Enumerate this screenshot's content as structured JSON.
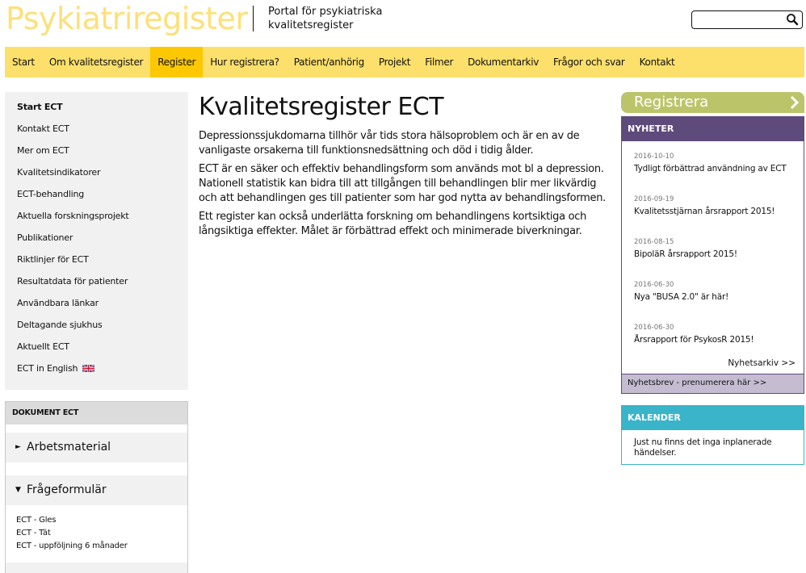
{
  "header": {
    "logo": "Psykiatriregister",
    "tagline_line1": "Portal för psykiatriska",
    "tagline_line2": "kvalitetsregister",
    "search": {
      "value": "",
      "placeholder": "",
      "icon": "search-icon"
    }
  },
  "nav": {
    "items": [
      {
        "label": "Start",
        "active": false
      },
      {
        "label": "Om kvalitetsregister",
        "active": false
      },
      {
        "label": "Register",
        "active": true
      },
      {
        "label": "Hur registrera?",
        "active": false
      },
      {
        "label": "Patient/anhörig",
        "active": false
      },
      {
        "label": "Projekt",
        "active": false
      },
      {
        "label": "Filmer",
        "active": false
      },
      {
        "label": "Dokumentarkiv",
        "active": false
      },
      {
        "label": "Frågor och svar",
        "active": false
      },
      {
        "label": "Kontakt",
        "active": false
      }
    ]
  },
  "sidebar": {
    "items": [
      {
        "label": "Start ECT",
        "active": true
      },
      {
        "label": "Kontakt ECT"
      },
      {
        "label": "Mer om ECT"
      },
      {
        "label": "Kvalitetsindikatorer"
      },
      {
        "label": "ECT-behandling"
      },
      {
        "label": "Aktuella forskningsprojekt"
      },
      {
        "label": "Publikationer"
      },
      {
        "label": "Riktlinjer för ECT"
      },
      {
        "label": "Resultatdata för patienter"
      },
      {
        "label": "Användbara länkar"
      },
      {
        "label": "Deltagande sjukhus"
      },
      {
        "label": "Aktuellt ECT"
      },
      {
        "label": "ECT in English",
        "icon": "uk-flag-icon"
      }
    ]
  },
  "documents": {
    "title": "DOKUMENT ECT",
    "sections": [
      {
        "label": "Arbetsmaterial",
        "expanded": false,
        "items": []
      },
      {
        "label": "Frågeformulär",
        "expanded": true,
        "items": [
          "ECT - Gles",
          "ECT - Tät",
          "ECT - uppföljning 6 månader"
        ]
      }
    ]
  },
  "main": {
    "title": "Kvalitetsregister ECT",
    "paragraphs": [
      "Depressionssjukdomarna tillhör vår tids stora hälsoproblem och är en av de vanligaste orsakerna till funktionsnedsättning och död i tidig ålder.",
      "ECT är en säker och effektiv behandlingsform som används mot bl a depression. Nationell statistik kan bidra till att tillgången till behandlingen blir mer likvärdig och att behandlingen ges till patienter som har god nytta av behandlingsformen.",
      "Ett register kan också underlätta forskning om behandlingens kortsiktiga och långsiktiga effekter. Målet är förbättrad effekt och minimerade biverkningar."
    ]
  },
  "right": {
    "register_button": "Registrera",
    "news": {
      "title": "NYHETER",
      "items": [
        {
          "date": "2016-10-10",
          "title": "Tydligt förbättrad användning av ECT"
        },
        {
          "date": "2016-09-19",
          "title": "Kvalitetsstjärnan årsrapport 2015!"
        },
        {
          "date": "2016-08-15",
          "title": "BipoläR årsrapport 2015!"
        },
        {
          "date": "2016-06-30",
          "title": "Nya \"BUSA 2.0\" är här!"
        },
        {
          "date": "2016-06-30",
          "title": "Årsrapport för PsykosR 2015!"
        }
      ],
      "archive_link": "Nyhetsarkiv >>",
      "newsletter_link": "Nyhetsbrev - prenumerera här >>"
    },
    "calendar": {
      "title": "KALENDER",
      "text": "Just nu finns det inga inplanerade händelser."
    }
  },
  "colors": {
    "logo": "#fde07a",
    "nav_bg": "#fde06b",
    "nav_active": "#fdc800",
    "register_button": "#bcc46a",
    "news": "#5f4a7c",
    "news_footer": "#c5bcd2",
    "calendar": "#3ab4c8",
    "sidebar_bg": "#f1f1f1"
  }
}
